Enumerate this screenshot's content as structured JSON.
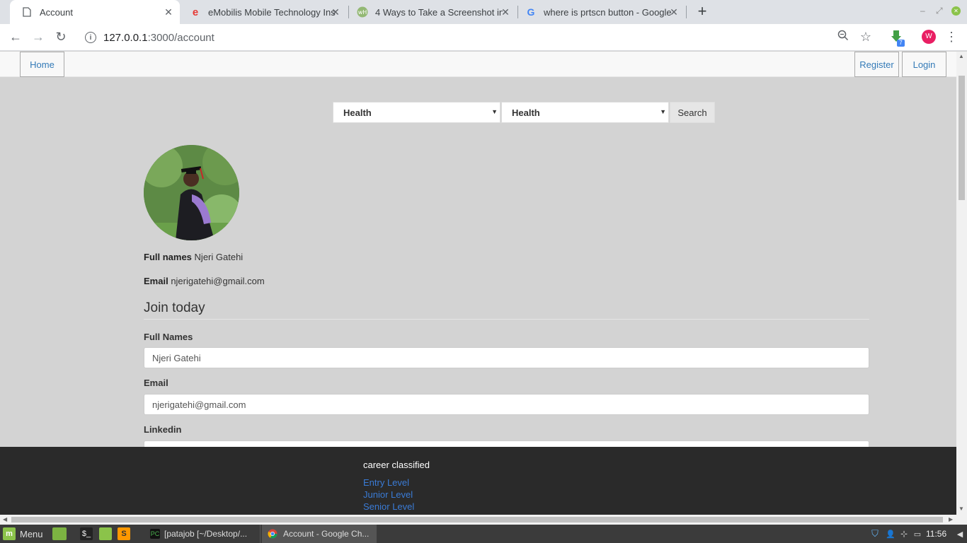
{
  "browser": {
    "tabs": [
      {
        "title": "Account",
        "favicon": "page-icon"
      },
      {
        "title": "eMobilis Mobile Technology Ins",
        "favicon": "e-icon"
      },
      {
        "title": "4 Ways to Take a Screenshot in",
        "favicon": "wikihow-icon"
      },
      {
        "title": "where is prtscn button - Google",
        "favicon": "google-icon"
      }
    ],
    "url_host": "127.0.0.1",
    "url_path": ":3000/account",
    "extension_badge": "7",
    "profile_initial": "W"
  },
  "navbar": {
    "home": "Home",
    "register": "Register",
    "login": "Login"
  },
  "search": {
    "select1": "Health",
    "select2": "Health",
    "button": "Search"
  },
  "profile": {
    "full_names_label": "Full names",
    "full_names_value": "Njeri Gatehi",
    "email_label": "Email",
    "email_value": "njerigatehi@gmail.com"
  },
  "form": {
    "heading": "Join today",
    "full_names_label": "Full Names",
    "full_names_value": "Njeri Gatehi",
    "email_label": "Email",
    "email_value": "njerigatehi@gmail.com",
    "linkedin_label": "Linkedin"
  },
  "footer": {
    "title": "career classified",
    "links": [
      "Entry Level",
      "Junior Level",
      "Senior Level"
    ]
  },
  "taskbar": {
    "menu": "Menu",
    "windows": [
      "[patajob [~/Desktop/...",
      "Account - Google Ch..."
    ],
    "clock": "11:56"
  },
  "colors": {
    "page_bg": "#d3d3d3",
    "link": "#337ab7",
    "footer_bg": "#2a2a2a"
  }
}
